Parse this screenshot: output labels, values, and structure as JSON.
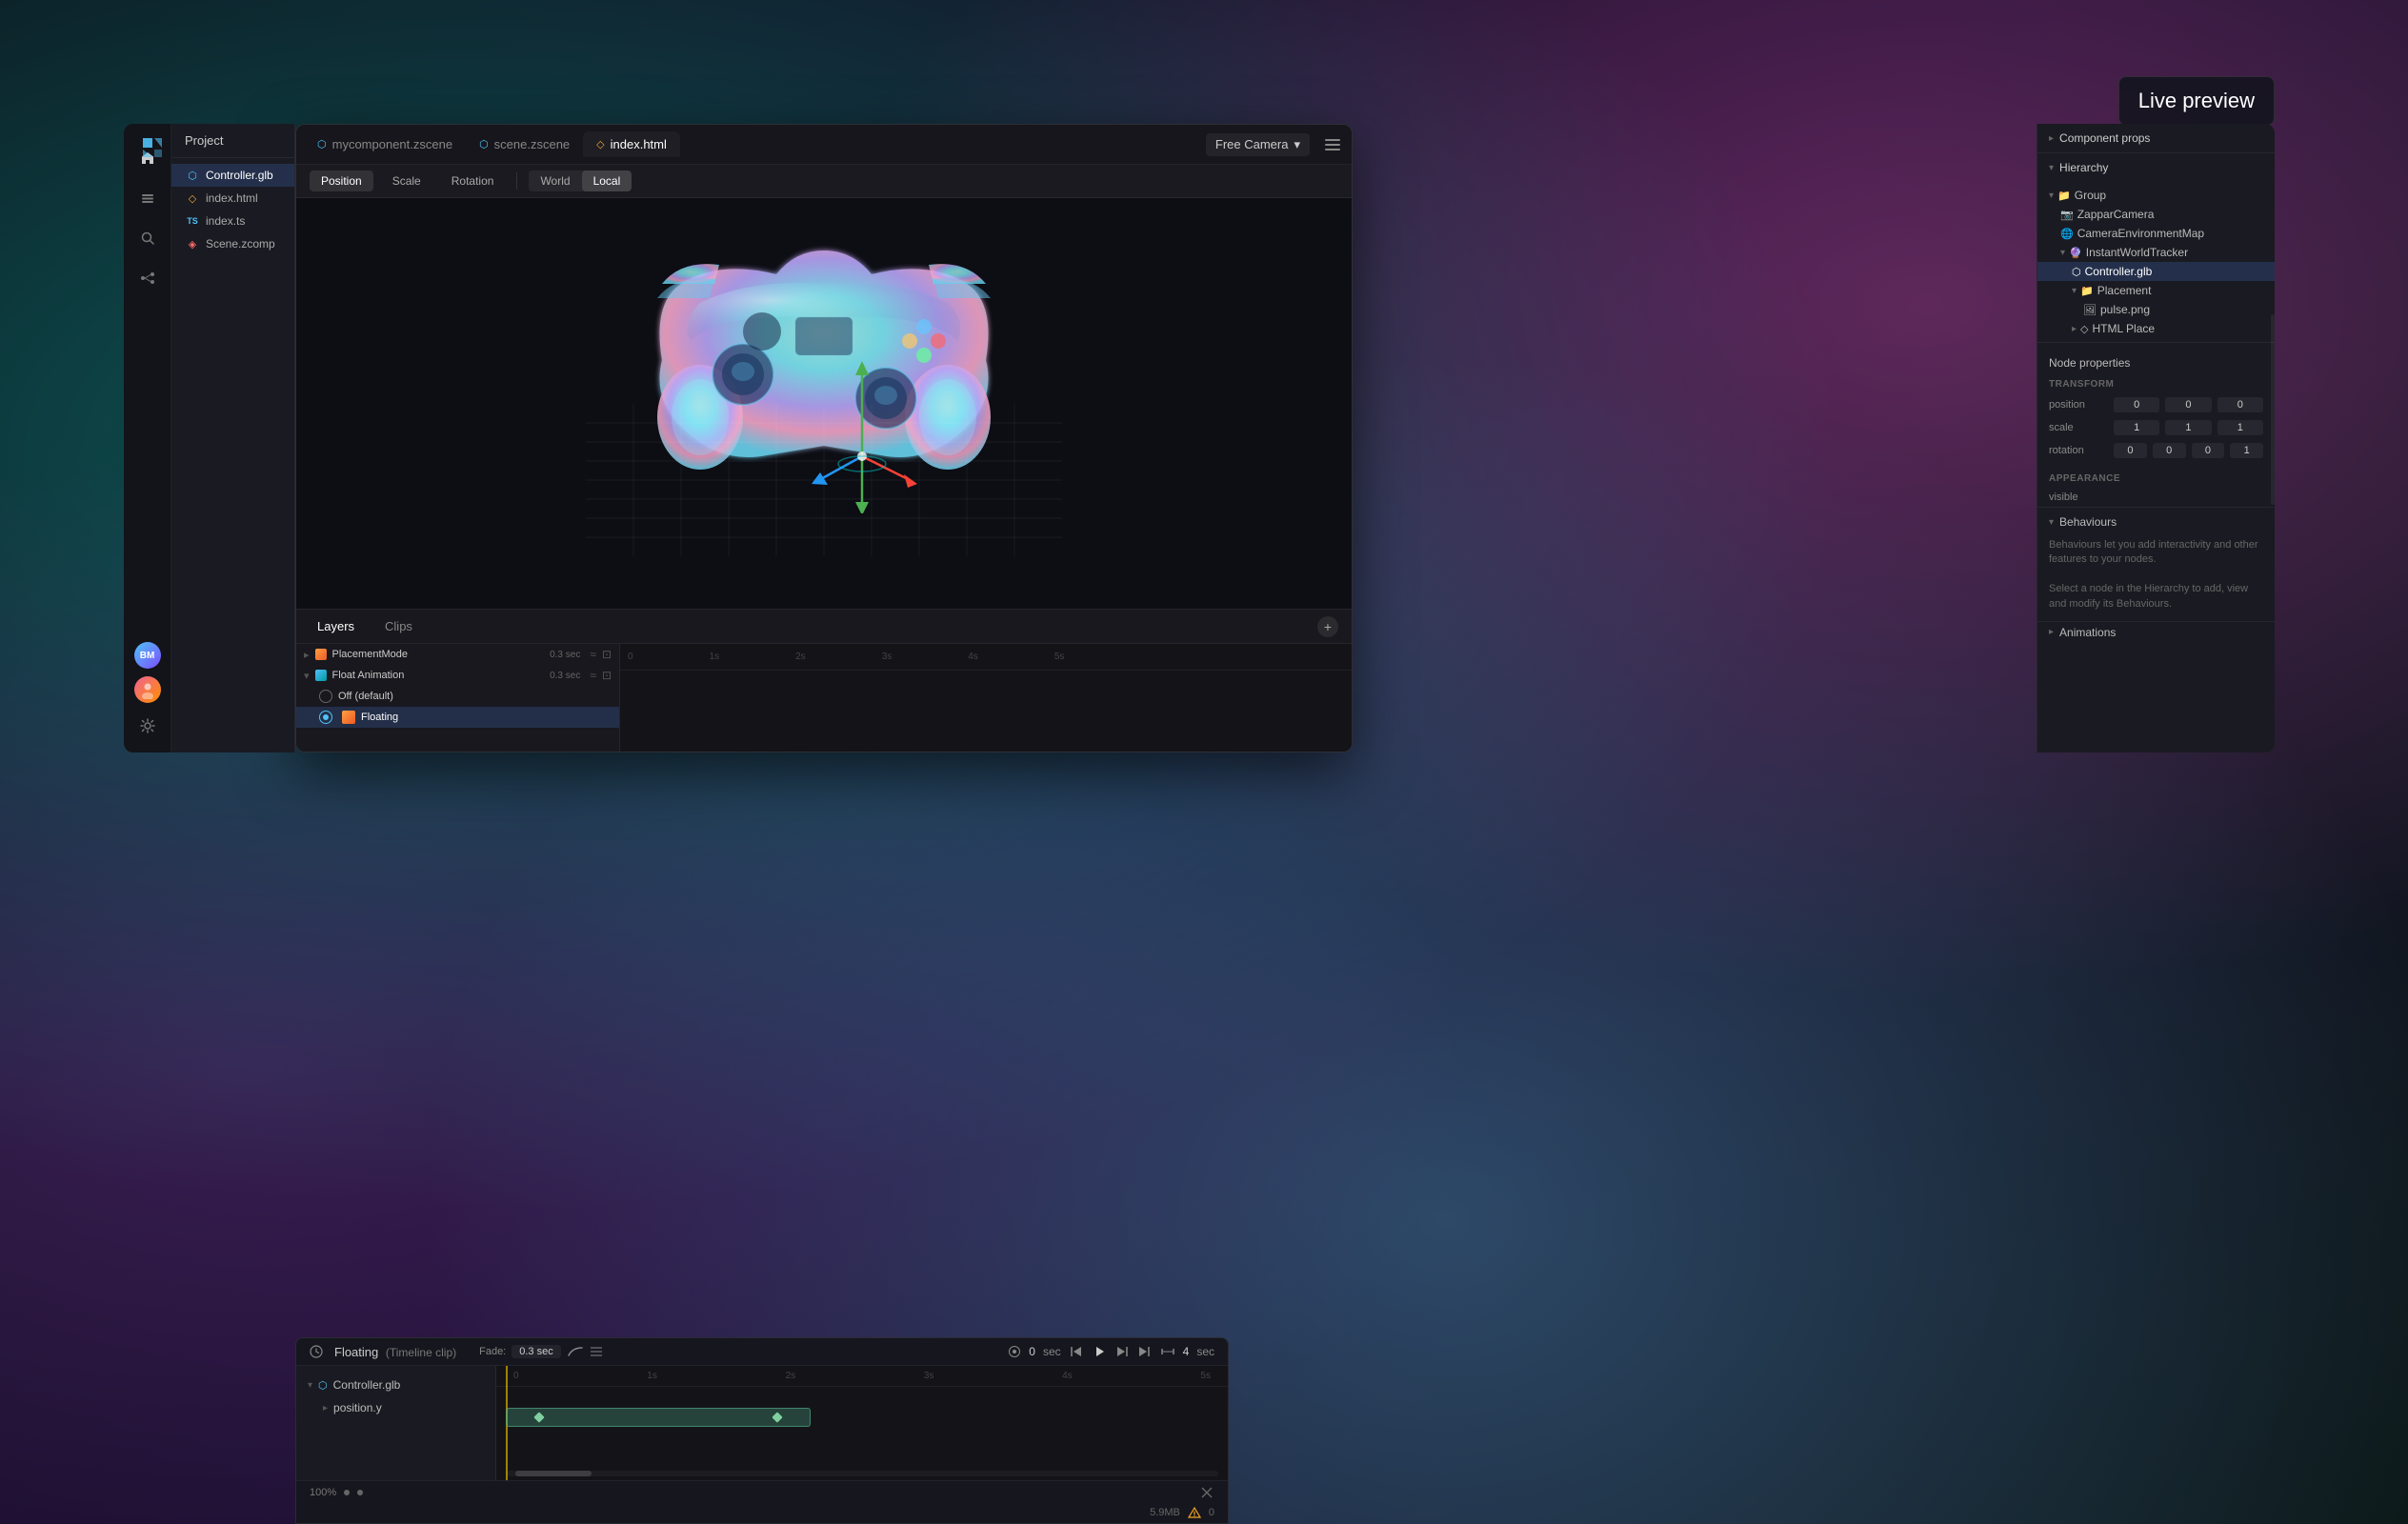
{
  "app": {
    "logo": "M",
    "live_preview_label": "Live preview"
  },
  "tabs": [
    {
      "id": "comp",
      "label": "mycomponent.zscene",
      "icon": "scene",
      "active": false
    },
    {
      "id": "scene",
      "label": "scene.zscene",
      "icon": "scene",
      "active": false
    },
    {
      "id": "html",
      "label": "index.html",
      "icon": "html",
      "active": true
    }
  ],
  "camera_selector": {
    "label": "Free Camera",
    "chevron": "▾"
  },
  "viewport_toolbar": {
    "position_btn": "Position",
    "scale_btn": "Scale",
    "rotation_btn": "Rotation",
    "world_btn": "World",
    "local_btn": "Local"
  },
  "project_panel": {
    "title": "Project",
    "files": [
      {
        "name": "Controller.glb",
        "icon": "🎮",
        "type": "glb",
        "active": true
      },
      {
        "name": "index.html",
        "icon": "◇",
        "type": "html"
      },
      {
        "name": "index.ts",
        "icon": "TS",
        "type": "ts"
      },
      {
        "name": "Scene.zcomp",
        "icon": "⚡",
        "type": "zcomp"
      }
    ]
  },
  "hierarchy": {
    "title": "Hierarchy",
    "items": [
      {
        "label": "Group",
        "indent": 0,
        "icon": "▾",
        "type": "group"
      },
      {
        "label": "ZapparCamera",
        "indent": 1,
        "icon": "📷",
        "type": "camera"
      },
      {
        "label": "CameraEnvironmentMap",
        "indent": 1,
        "icon": "🌐",
        "type": "env"
      },
      {
        "label": "InstantWorldTracker",
        "indent": 1,
        "icon": "🔮",
        "type": "tracker",
        "expanded": true
      },
      {
        "label": "Controller.glb",
        "indent": 2,
        "icon": "🎮",
        "type": "glb",
        "selected": true
      },
      {
        "label": "Placement",
        "indent": 2,
        "icon": "📁",
        "type": "folder"
      },
      {
        "label": "pulse.png",
        "indent": 3,
        "icon": "🖼",
        "type": "image"
      },
      {
        "label": "HTML Place",
        "indent": 2,
        "icon": "◇",
        "type": "html"
      }
    ]
  },
  "node_properties": {
    "section_label": "Node properties",
    "transform_label": "TRANSFORM",
    "position_label": "position",
    "position_values": [
      "0",
      "0",
      "0"
    ],
    "scale_label": "scale",
    "scale_values": [
      "1",
      "1",
      "1"
    ],
    "rotation_label": "rotation",
    "rotation_values": [
      "0",
      "0",
      "0",
      "1"
    ],
    "appearance_label": "APPEARANCE",
    "visible_label": "visible",
    "behaviours_title": "Behaviours",
    "behaviours_desc": "Behaviours let you add interactivity and other features to your nodes.\n\nSelect a node in the Hierarchy to add, view and modify its Behaviours.",
    "animations_label": "Animations"
  },
  "component_props": {
    "label": "Component props"
  },
  "timeline": {
    "layers_tab": "Layers",
    "clips_tab": "Clips",
    "clip_title": "Floating",
    "clip_subtitle": "(Timeline clip)",
    "fade_label": "Fade:",
    "fade_value": "0.3 sec",
    "time_display": "0  sec",
    "end_time": "4  sec",
    "items": [
      {
        "label": "PlacementMode",
        "time": "0.3 sec"
      },
      {
        "label": "Float Animation",
        "time": "0.3 sec"
      },
      {
        "label": "Off (default)",
        "radio_selected": false
      },
      {
        "label": "Floating",
        "radio_selected": true,
        "selected": true
      }
    ],
    "tree_items": [
      {
        "label": "Controller.glb",
        "indent": 0
      },
      {
        "label": "position.y",
        "indent": 1
      }
    ],
    "zoom": "100%",
    "memory": "5.9MB",
    "warnings": "0"
  }
}
